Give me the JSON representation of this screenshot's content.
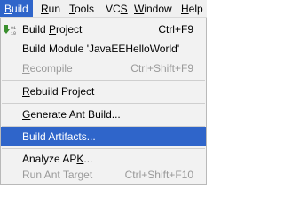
{
  "menubar": {
    "items": [
      {
        "label": "Build",
        "mnemonic": "B",
        "rest": "uild",
        "active": true
      },
      {
        "label": "Run",
        "mnemonic": "R",
        "rest": "un"
      },
      {
        "label": "Tools",
        "mnemonic": "T",
        "rest": "ools"
      },
      {
        "label": "VCS",
        "mnemonic": "S",
        "rest": "",
        "prefix": "VC"
      },
      {
        "label": "Window",
        "mnemonic": "W",
        "rest": "indow"
      },
      {
        "label": "Help",
        "mnemonic": "H",
        "rest": "elp"
      }
    ]
  },
  "menu": {
    "build_project": {
      "pre": "Build ",
      "mn": "P",
      "post": "roject",
      "shortcut": "Ctrl+F9",
      "icon": "build-icon"
    },
    "build_module": {
      "label": "Build Module 'JavaEEHelloWorld'"
    },
    "recompile": {
      "pre": "",
      "mn": "R",
      "post": "ecompile",
      "shortcut": "Ctrl+Shift+F9"
    },
    "rebuild_project": {
      "pre": "",
      "mn": "R",
      "post": "ebuild Project"
    },
    "generate_ant_build": {
      "pre": "",
      "mn": "G",
      "post": "enerate Ant Build..."
    },
    "build_artifacts": {
      "label": "Build Artifacts..."
    },
    "analyze_apk": {
      "pre": "Analyze AP",
      "mn": "K",
      "post": "..."
    },
    "run_ant_target": {
      "label": "Run Ant Target",
      "shortcut": "Ctrl+Shift+F10"
    }
  },
  "colors": {
    "selection": "#2f65ca",
    "menu_background": "#f2f2f2",
    "disabled_text": "#9a9a9a"
  }
}
